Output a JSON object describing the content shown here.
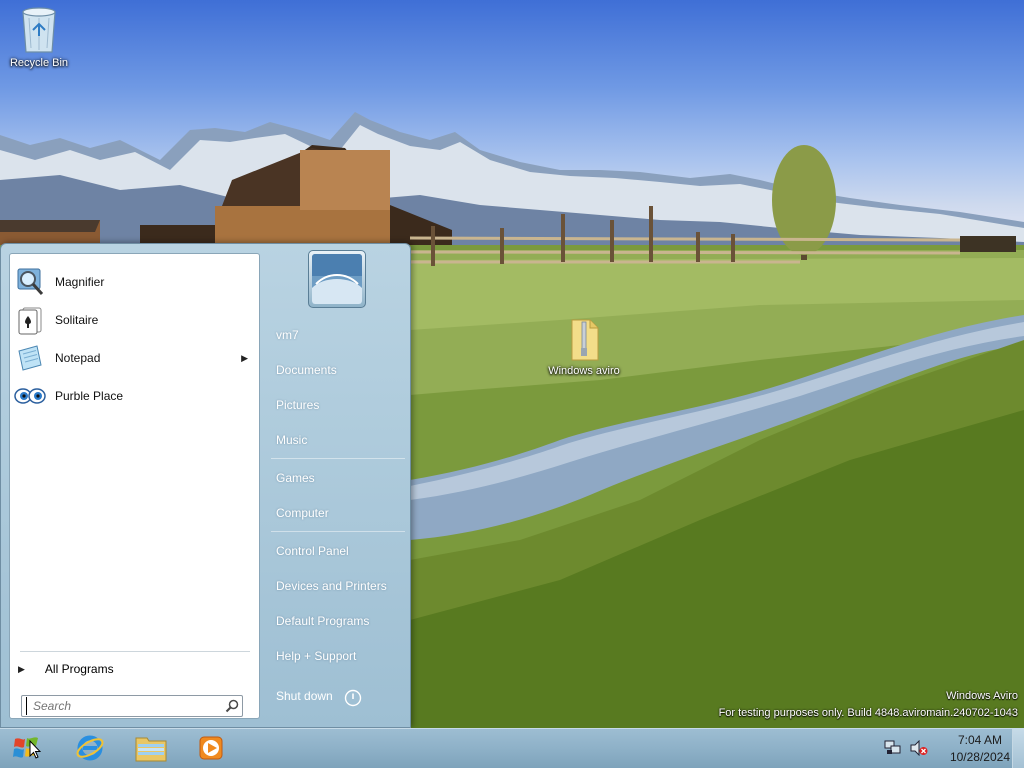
{
  "desktop": {
    "icons": [
      {
        "label": "Recycle Bin",
        "icon": "recycle-bin-icon"
      },
      {
        "label": "Windows aviro",
        "icon": "zip-folder-icon"
      }
    ],
    "watermark": {
      "line1": "Windows Aviro",
      "line2": "For testing purposes only. Build 4848.aviromain.240702-1043"
    }
  },
  "start_menu": {
    "pinned": [
      {
        "label": "Magnifier",
        "icon": "magnifier-icon",
        "has_submenu": false
      },
      {
        "label": "Solitaire",
        "icon": "solitaire-icon",
        "has_submenu": false
      },
      {
        "label": "Notepad",
        "icon": "notepad-icon",
        "has_submenu": true
      },
      {
        "label": "Purble Place",
        "icon": "purble-place-icon",
        "has_submenu": false
      }
    ],
    "all_programs": "All Programs",
    "search_placeholder": "Search",
    "right_items": [
      "vm7",
      "Documents",
      "Pictures",
      "Music",
      "Games",
      "Computer",
      "Control Panel",
      "Devices and Printers",
      "Default Programs",
      "Help + Support"
    ],
    "shutdown_label": "Shut down"
  },
  "taskbar": {
    "buttons": [
      "start-orb-icon",
      "internet-explorer-icon",
      "file-explorer-icon",
      "media-player-icon"
    ],
    "tray": {
      "icons": [
        "network-icon",
        "volume-muted-icon"
      ],
      "time": "7:04 AM",
      "date": "10/28/2024"
    }
  },
  "colors": {
    "taskbar": "#8eb1c8",
    "start_menu_right": "#a7c5d8",
    "start_menu_left": "#ffffff"
  }
}
